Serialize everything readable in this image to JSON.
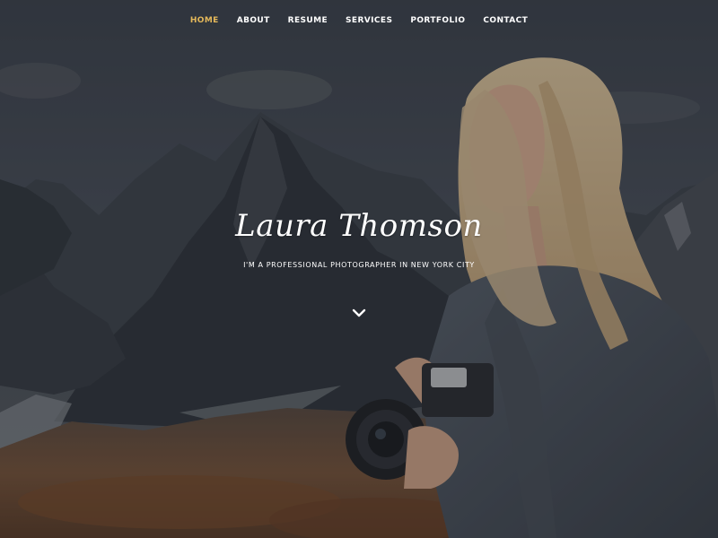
{
  "nav": {
    "items": [
      {
        "label": "HOME",
        "active": true
      },
      {
        "label": "ABOUT",
        "active": false
      },
      {
        "label": "RESUME",
        "active": false
      },
      {
        "label": "SERVICES",
        "active": false
      },
      {
        "label": "PORTFOLIO",
        "active": false
      },
      {
        "label": "CONTACT",
        "active": false
      }
    ],
    "active_color": "#e4b85a",
    "color": "#ffffff"
  },
  "hero": {
    "name": "Laura Thomson",
    "tagline": "I'M A PROFESSIONAL PHOTOGRAPHER IN NEW YORK CITY",
    "scroll_icon": "chevron-down-icon"
  }
}
